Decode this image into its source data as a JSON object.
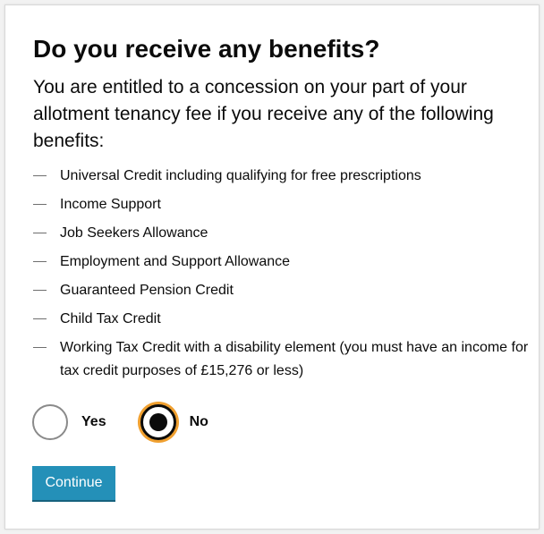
{
  "question": {
    "title": "Do you receive any benefits?",
    "intro": "You are entitled to a concession on your part of your allotment tenancy fee if you receive any of the following benefits:"
  },
  "benefits": [
    "Universal Credit including qualifying for free prescriptions",
    "Income Support",
    "Job Seekers Allowance",
    "Employment and Support Allowance",
    "Guaranteed Pension Credit",
    "Child Tax Credit",
    "Working Tax Credit with a disability element (you must have an income for tax credit purposes of £15,276 or less)"
  ],
  "radio": {
    "yes_label": "Yes",
    "no_label": "No",
    "selected": "No"
  },
  "actions": {
    "continue_label": "Continue"
  },
  "colors": {
    "button": "#2490b8",
    "focus_ring": "#f0a030",
    "text": "#0b0b0b"
  }
}
